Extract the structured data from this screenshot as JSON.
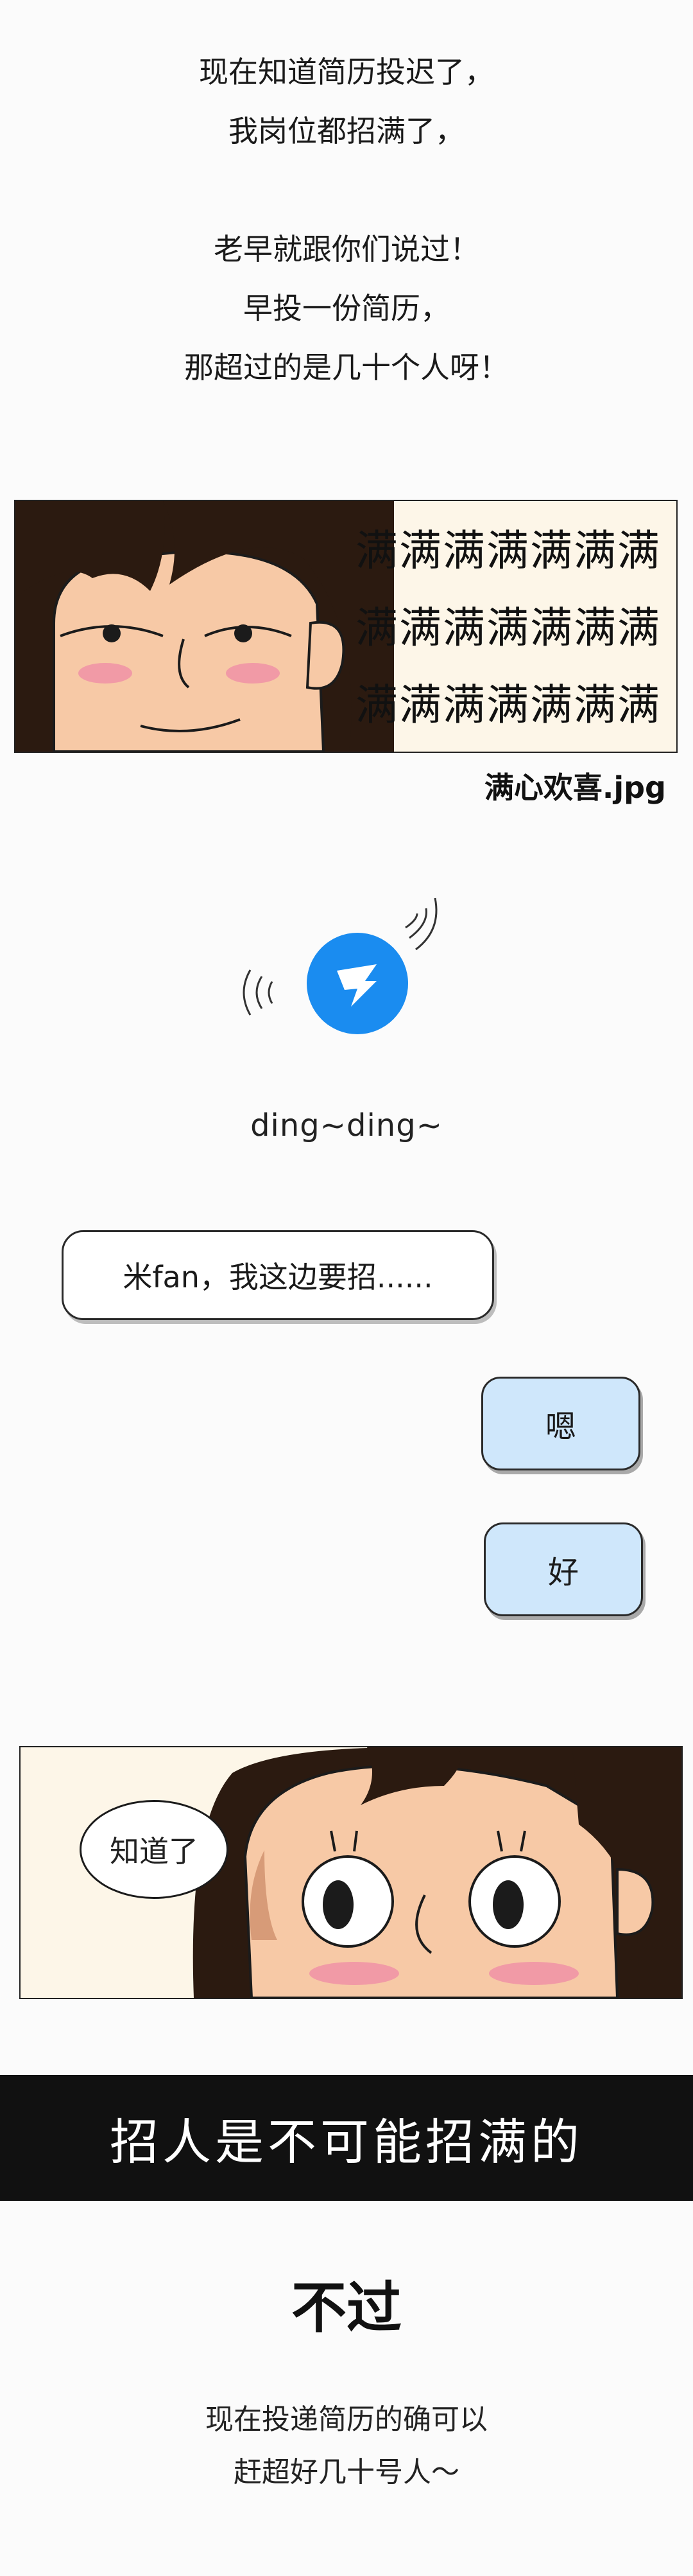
{
  "intro": {
    "lines": [
      "现在知道简历投迟了，",
      "我岗位都招满了，",
      "",
      "老早就跟你们说过！",
      "早投一份简历，",
      "那超过的是几十个人呀！"
    ]
  },
  "panel1": {
    "grid_rows": [
      "满满满满满满满",
      "满满满满满满满",
      "满满满满满满满"
    ],
    "caption": "满心欢喜.jpg"
  },
  "notification": {
    "icon": "dingtalk-icon",
    "sound_text": "ding~ding~",
    "accent_color": "#1a8cf0"
  },
  "chat": {
    "incoming": "米fan，我这边要招......",
    "reply1": "嗯",
    "reply2": "好"
  },
  "panel2": {
    "speech": "知道了"
  },
  "banner": {
    "text": "招人是不可能招满的"
  },
  "closing": {
    "heading": "不过",
    "lines": [
      "现在投递简历的确可以",
      "赶超好几十号人～"
    ]
  }
}
